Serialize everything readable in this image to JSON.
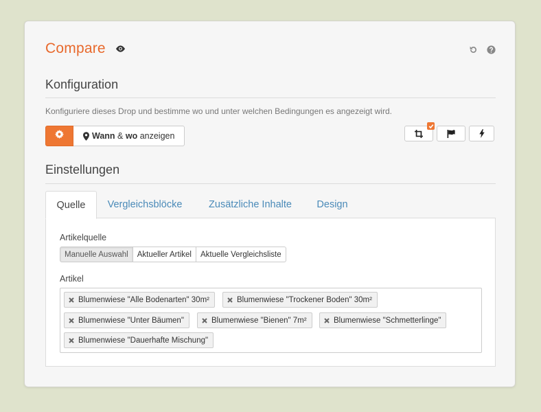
{
  "header": {
    "title": "Compare",
    "icons": [
      "eye-icon",
      "undo-icon",
      "help-icon"
    ]
  },
  "konfiguration": {
    "heading": "Konfiguration",
    "description": "Konfiguriere dieses Drop und bestimme wo und unter welchen Bedingungen es angezeigt wird.",
    "gear_icon": "gear-icon",
    "display_button": {
      "icon": "map-marker-icon",
      "bold1": "Wann",
      "amp": " & ",
      "bold2": "wo",
      "rest": " anzeigen"
    },
    "icon_buttons": [
      "crop-icon",
      "flag-icon",
      "bolt-icon"
    ],
    "badge_icon": "check-icon"
  },
  "einstellungen": {
    "heading": "Einstellungen",
    "tabs": [
      {
        "label": "Quelle",
        "active": true
      },
      {
        "label": "Vergleichsblöcke",
        "active": false
      },
      {
        "label": "Zusätzliche Inhalte",
        "active": false
      },
      {
        "label": "Design",
        "active": false
      }
    ],
    "artikelquelle": {
      "label": "Artikelquelle",
      "options": [
        "Manuelle Auswahl",
        "Aktueller Artikel",
        "Aktuelle Vergleichsliste"
      ],
      "selected": "Manuelle Auswahl"
    },
    "artikel": {
      "label": "Artikel",
      "tags": [
        "Blumenwiese \"Alle Bodenarten\" 30m²",
        "Blumenwiese \"Trockener Boden\" 30m²",
        "Blumenwiese \"Unter Bäumen\"",
        "Blumenwiese \"Bienen\" 7m²",
        "Blumenwiese \"Schmetterlinge\"",
        "Blumenwiese \"Dauerhafte Mischung\""
      ]
    }
  },
  "colors": {
    "accent": "#ee7733",
    "title": "#e8692c",
    "link": "#4a8ab8",
    "background": "#dfe3cc",
    "panel": "#f6f6f6"
  }
}
